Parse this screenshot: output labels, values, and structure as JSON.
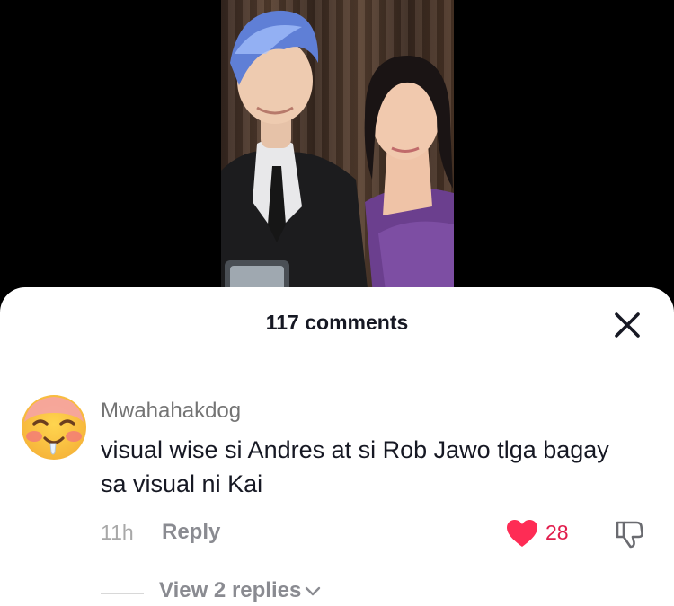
{
  "comments_sheet": {
    "title": "117 comments",
    "close_icon": "close-icon"
  },
  "comment": {
    "username": "Mwahahakdog",
    "text": "visual wise si Andres at si Rob Jawo tlga bagay sa visual ni Kai",
    "time": "11h",
    "reply_label": "Reply",
    "like_count": "28",
    "like_icon": "heart-icon",
    "dislike_icon": "thumbs-down-icon",
    "avatar_icon": "drooling-face-emoji"
  },
  "replies": {
    "view_label": "View 2 replies",
    "chevron_icon": "chevron-down-icon"
  },
  "colors": {
    "like": "#fe2c55",
    "like_count_text": "#e11c4c",
    "sheet_bg": "#ffffff",
    "secondary_text": "#8a8b91"
  }
}
